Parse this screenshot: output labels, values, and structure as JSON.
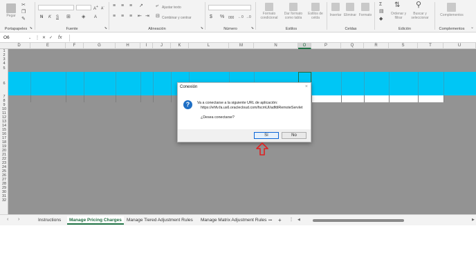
{
  "ribbon": {
    "groups": [
      {
        "label": "Portapapeles",
        "buttons": [
          "Pegar"
        ]
      },
      {
        "label": "Fuente"
      },
      {
        "label": "Alineación",
        "buttons": [
          "Ajustar texto",
          "Combinar y centrar"
        ]
      },
      {
        "label": "Número"
      },
      {
        "label": "Estilos",
        "buttons": [
          "Formato condicional",
          "Dar formato como tabla",
          "Estilos de celda"
        ]
      },
      {
        "label": "Celdas",
        "buttons": [
          "Insertar",
          "Eliminar",
          "Formato"
        ]
      },
      {
        "label": "Edición",
        "buttons": [
          "Ordenar y filtrar",
          "Buscar y seleccionar"
        ]
      },
      {
        "label": "Complementos",
        "buttons": [
          "Complementos"
        ]
      }
    ],
    "font_buttons": [
      "N",
      "K",
      "S"
    ],
    "number_symbols": [
      "$",
      "%",
      "000"
    ]
  },
  "formula_bar": {
    "name_box": "O6",
    "fx_label": "fx",
    "formula": ""
  },
  "grid": {
    "columns": [
      "D",
      "E",
      "F",
      "G",
      "H",
      "I",
      "J",
      "K",
      "L",
      "M",
      "N",
      "O",
      "P",
      "Q",
      "R",
      "S",
      "T",
      "U"
    ],
    "active_column": "O",
    "rows": [
      "1",
      "2",
      "3",
      "4",
      "5",
      "6",
      "7",
      "8",
      "9",
      "10",
      "11",
      "12",
      "13",
      "14",
      "15",
      "16",
      "17",
      "18",
      "19",
      "20",
      "21",
      "22",
      "23",
      "24",
      "25",
      "26",
      "27",
      "28",
      "29",
      "30",
      "31",
      "32"
    ],
    "band_color": "#00c6f5"
  },
  "sheet_tabs": {
    "tabs": [
      "Instructions",
      "Manage Pricing Charges",
      "Manage Tiered Adjustment Rules",
      "Manage Matrix Adjustment Rules"
    ],
    "active_index": 1,
    "more": "•••",
    "add": "+"
  },
  "dialog": {
    "title": "Conexión",
    "close": "×",
    "icon": "?",
    "message": "Va a conectarse a la siguiente URL de aplicación:",
    "url": "https://ehfv.fa.us6.oraclecloud.com/fscmUI/adfdiRemoteServlet",
    "question": "¿Desea conectarse?",
    "yes_label": "Sí",
    "no_label": "No"
  },
  "annotation": {
    "arrow_color": "#e02020",
    "icon": "red-arrow-up-icon"
  }
}
